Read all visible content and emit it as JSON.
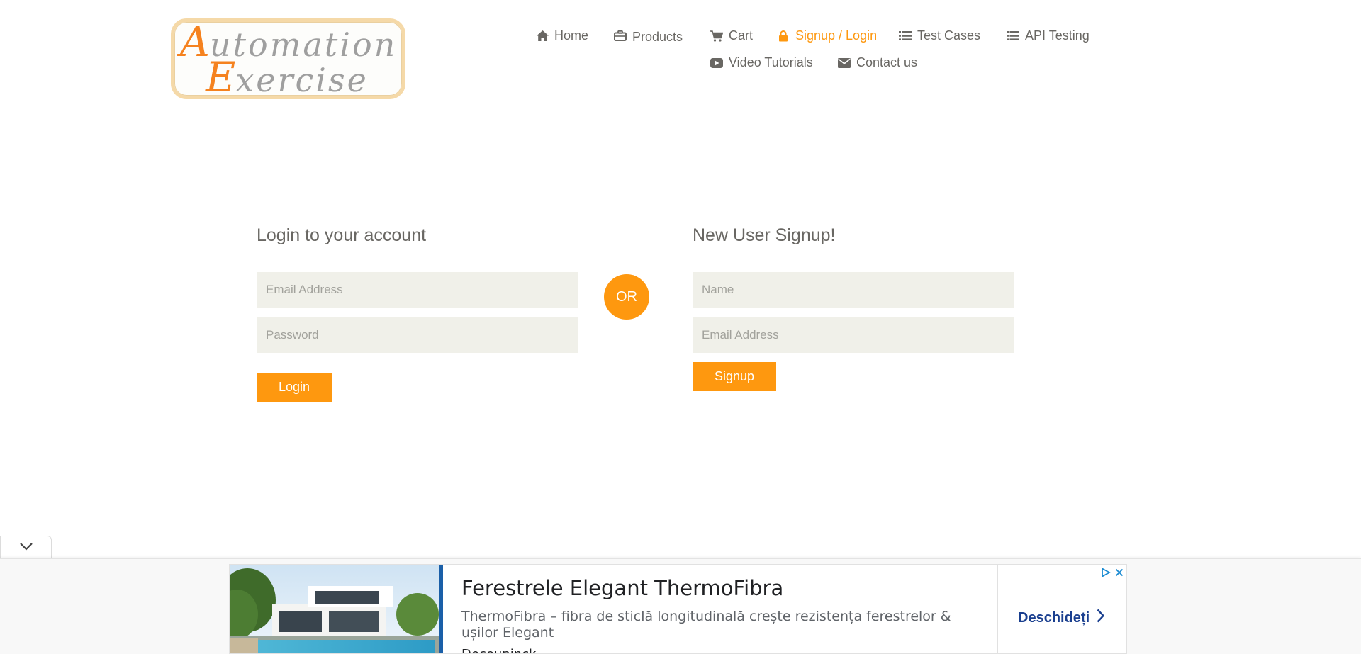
{
  "brand": {
    "logo_first_big": "A",
    "logo_first_rest": "utomation",
    "logo_second_big": "E",
    "logo_second_rest": "xercise"
  },
  "nav": {
    "items": [
      {
        "label": "Home",
        "icon": "home-icon"
      },
      {
        "label": "Products",
        "icon": "briefcase-icon"
      },
      {
        "label": "Cart",
        "icon": "cart-icon"
      },
      {
        "label": "Signup / Login",
        "icon": "lock-icon",
        "active": true
      },
      {
        "label": "Test Cases",
        "icon": "list-icon"
      },
      {
        "label": "API Testing",
        "icon": "list-icon"
      },
      {
        "label": "Video Tutorials",
        "icon": "youtube-play-icon"
      },
      {
        "label": "Contact us",
        "icon": "envelope-icon"
      }
    ]
  },
  "login": {
    "title": "Login to your account",
    "email_placeholder": "Email Address",
    "password_placeholder": "Password",
    "button_label": "Login"
  },
  "or_label": "OR",
  "signup": {
    "title": "New User Signup!",
    "name_placeholder": "Name",
    "email_placeholder": "Email Address",
    "button_label": "Signup"
  },
  "ad": {
    "headline": "Ferestrele Elegant ThermoFibra",
    "description": "ThermoFibra – fibra de sticlă longitudinală crește rezistența ferestrelor & ușilor Elegant",
    "advertiser": "Deceuninck",
    "cta_label": "Deschideți"
  },
  "colors": {
    "accent": "#fe980f",
    "text": "#696763",
    "input_bg": "#f0f0e9",
    "cta_text": "#1a3f8f"
  }
}
